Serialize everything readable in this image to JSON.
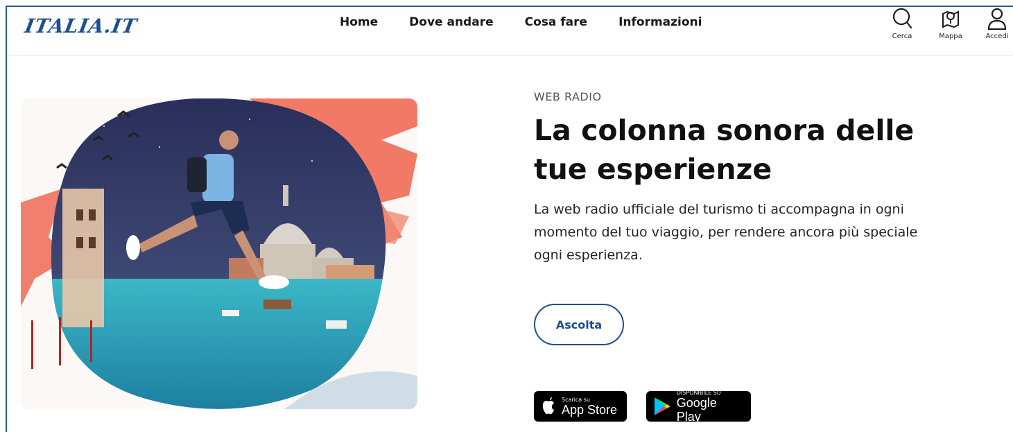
{
  "header": {
    "logo_text": "ITALIA.IT",
    "nav": [
      {
        "label": "Home"
      },
      {
        "label": "Dove andare"
      },
      {
        "label": "Cosa fare"
      },
      {
        "label": "Informazioni"
      }
    ],
    "tools": {
      "search": {
        "label": "Cerca",
        "icon": "search-icon"
      },
      "map": {
        "label": "Mappa",
        "icon": "map-icon"
      },
      "login": {
        "label": "Accedi",
        "icon": "user-icon"
      }
    }
  },
  "hero": {
    "eyebrow": "WEB RADIO",
    "headline": "La colonna sonora delle tue esperienze",
    "description": "La web radio ufficiale del turismo ti accompagna in ogni momento del tuo viaggio, per rendere ancora più speciale ogni esperienza.",
    "button_label": "Ascolta"
  },
  "stores": {
    "apple": {
      "small": "Scarica su",
      "big": "App Store"
    },
    "google": {
      "small": "DISPONIBILE SU",
      "big": "Google Play"
    }
  },
  "colors": {
    "brand_blue": "#1c4f8c",
    "accent_coral": "#ef6a55"
  }
}
